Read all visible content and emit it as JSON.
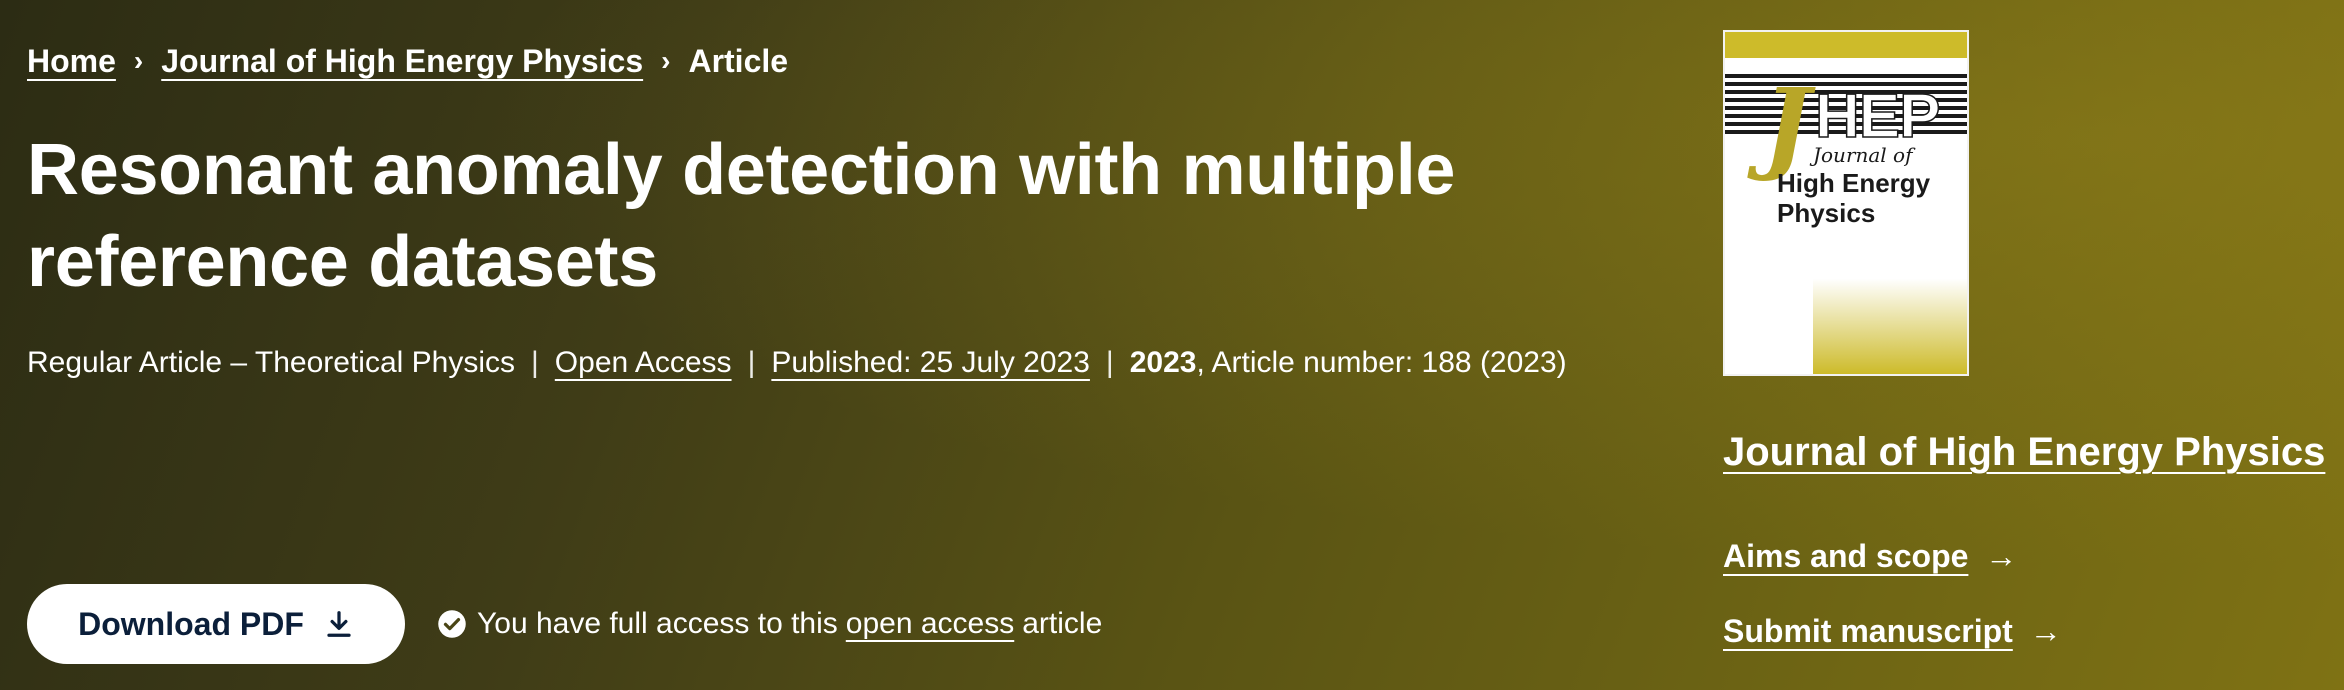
{
  "breadcrumb": {
    "home": "Home",
    "journal": "Journal of High Energy Physics",
    "current": "Article",
    "separator": "›"
  },
  "article": {
    "title": "Resonant anomaly detection with multiple reference datasets",
    "type": "Regular Article – Theoretical Physics",
    "access": "Open Access",
    "published": "Published: 25 July 2023",
    "year": "2023",
    "article_number": ", Article number: 188 (2023)"
  },
  "actions": {
    "download_label": "Download PDF",
    "access_prefix": "You have full access to this",
    "access_link": "open access",
    "access_suffix": "article"
  },
  "sidebar": {
    "cover_logo": "JHEP",
    "cover_title_line1": "Journal of",
    "cover_title_line2": "High Energy",
    "cover_title_line3": "Physics",
    "journal_title": "Journal of High Energy Physics",
    "aims_label": "Aims and scope",
    "submit_label": "Submit manuscript",
    "arrow": "→"
  },
  "colors": {
    "background_start": "#2c2c14",
    "background_end": "#7f7214",
    "button_text": "#0b1f3a",
    "cover_accent": "#cdbb2a"
  },
  "icons": {
    "download": "download-icon",
    "check": "check-circle-icon"
  }
}
